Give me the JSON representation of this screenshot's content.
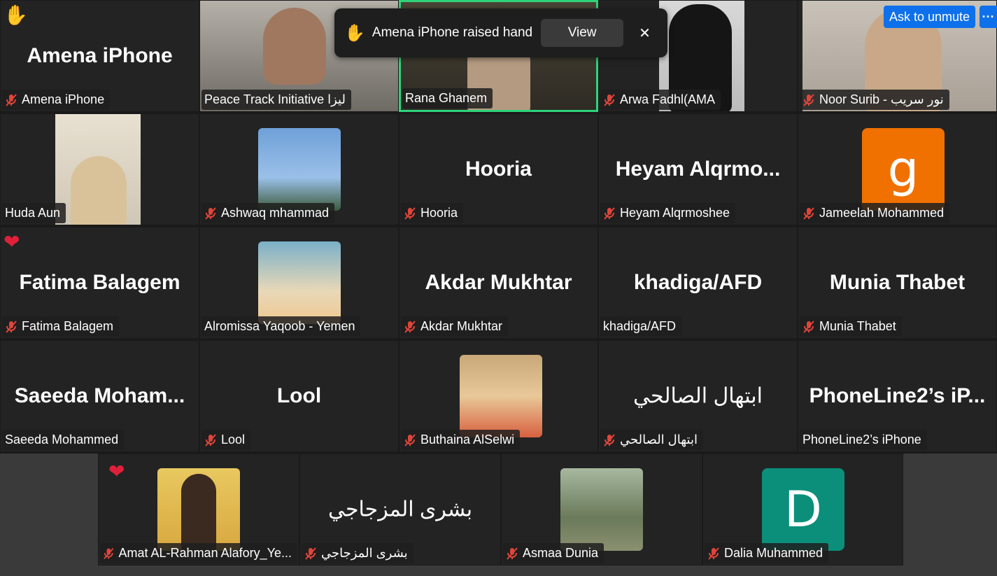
{
  "notification": {
    "text": "Amena iPhone raised hand",
    "view_label": "View",
    "close_label": "✕"
  },
  "controls": {
    "ask_unmute": "Ask to unmute",
    "more": "···"
  },
  "participants": [
    {
      "display": "Amena iPhone",
      "label": "Amena iPhone"
    },
    {
      "display": "",
      "label": "Peace Track Initiative ليزا"
    },
    {
      "display": "",
      "label": "Rana Ghanem"
    },
    {
      "display": "",
      "label": "Arwa Fadhl(AMA"
    },
    {
      "display": "",
      "label": "Noor Surib - نور سريب"
    },
    {
      "display": "",
      "label": "Huda Aun"
    },
    {
      "display": "",
      "label": "Ashwaq mhammad"
    },
    {
      "display": "Hooria",
      "label": "Hooria"
    },
    {
      "display": "Heyam  Alqrmo...",
      "label": "Heyam Alqrmoshee"
    },
    {
      "display": "",
      "label": "Jameelah Mohammed",
      "avatar_letter": "g"
    },
    {
      "display": "Fatima Balagem",
      "label": "Fatima Balagem"
    },
    {
      "display": "",
      "label": "Alromissa Yaqoob - Yemen"
    },
    {
      "display": "Akdar Mukhtar",
      "label": "Akdar Mukhtar"
    },
    {
      "display": "khadiga/AFD",
      "label": "khadiga/AFD"
    },
    {
      "display": "Munia Thabet",
      "label": "Munia Thabet"
    },
    {
      "display": "Saeeda  Moham...",
      "label": "Saeeda Mohammed"
    },
    {
      "display": "Lool",
      "label": "Lool"
    },
    {
      "display": "",
      "label": "Buthaina AlSelwi"
    },
    {
      "display": "ابتهال الصالحي",
      "label": "ابتهال الصالحي"
    },
    {
      "display": "PhoneLine2’s  iP...",
      "label": "PhoneLine2’s iPhone"
    },
    {
      "display": "",
      "label": "Amat AL-Rahman Alafory_Ye..."
    },
    {
      "display": "بشرى المزجاجي",
      "label": "بشرى المزجاجي"
    },
    {
      "display": "",
      "label": "Asmaa Dunia"
    },
    {
      "display": "",
      "label": "Dalia Muhammed",
      "avatar_letter": "D"
    }
  ],
  "colors": {
    "active_speaker": "#2ed47a",
    "tile_bg": "#232323",
    "accent_blue": "#0e71eb",
    "avatar_orange": "#f07000",
    "avatar_teal": "#0b8f7a"
  }
}
